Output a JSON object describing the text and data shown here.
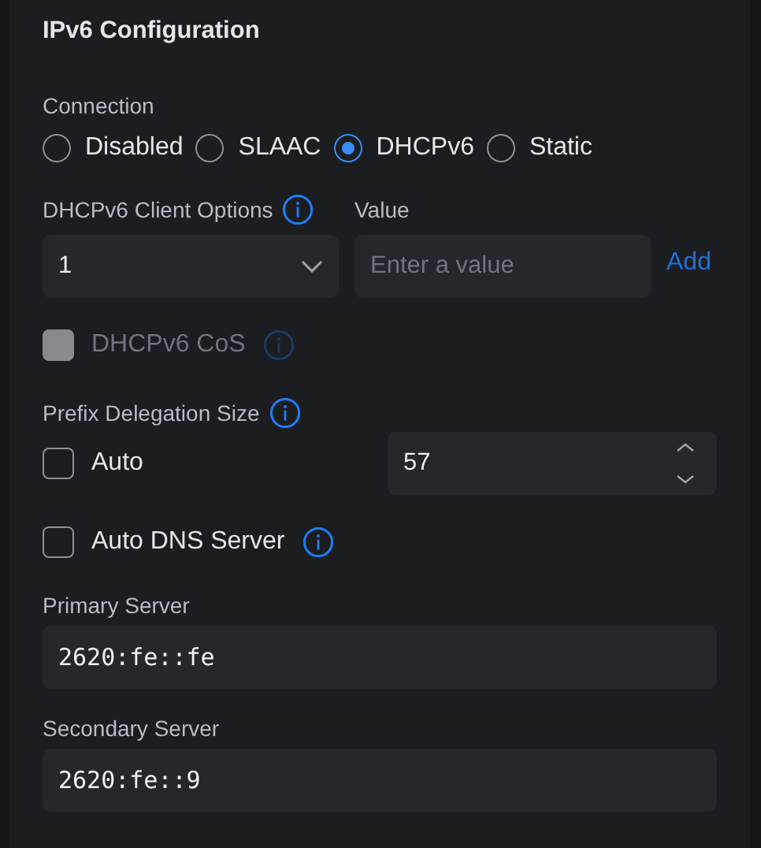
{
  "title": "IPv6 Configuration",
  "connection": {
    "label": "Connection",
    "options": [
      {
        "label": "Disabled",
        "selected": false
      },
      {
        "label": "SLAAC",
        "selected": false
      },
      {
        "label": "DHCPv6",
        "selected": true
      },
      {
        "label": "Static",
        "selected": false
      }
    ]
  },
  "client_options": {
    "label": "DHCPv6 Client Options",
    "select_value": "1",
    "value_label": "Value",
    "value_placeholder": "Enter a value",
    "add": "Add"
  },
  "cos": {
    "label": "DHCPv6 CoS",
    "checked": false,
    "disabled": true
  },
  "prefix_delegation": {
    "label": "Prefix Delegation Size",
    "auto": {
      "label": "Auto",
      "checked": false,
      "disabled": false
    },
    "value": "57"
  },
  "auto_dns": {
    "label": "Auto DNS Server",
    "checked": false,
    "disabled": false
  },
  "servers": [
    {
      "label": "Primary Server",
      "value": "2620:fe::fe"
    },
    {
      "label": "Secondary Server",
      "value": "2620:fe::9"
    }
  ]
}
